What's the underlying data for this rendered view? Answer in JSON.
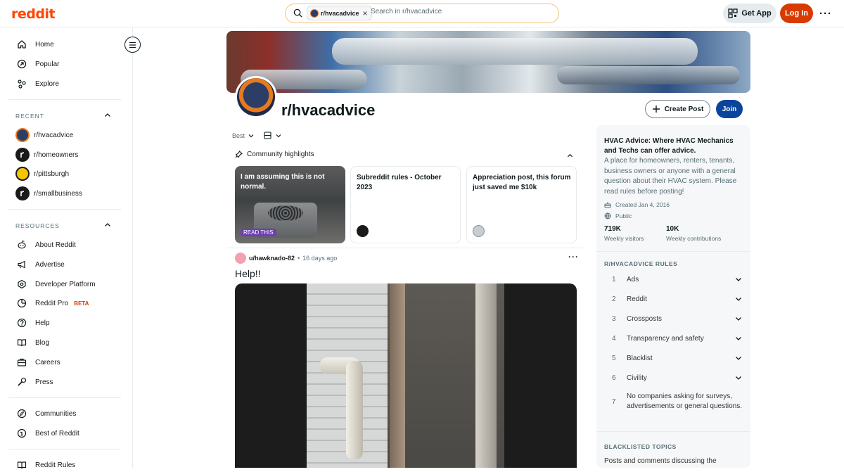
{
  "header": {
    "logo": "reddit",
    "search_chip": "r/hvacadvice",
    "search_placeholder": "Search in r/hvacadvice",
    "get_app": "Get App",
    "login": "Log In"
  },
  "sidebar": {
    "nav": [
      {
        "label": "Home",
        "icon": "home-icon"
      },
      {
        "label": "Popular",
        "icon": "popular-icon"
      },
      {
        "label": "Explore",
        "icon": "explore-icon"
      }
    ],
    "recent_title": "RECENT",
    "recent": [
      {
        "label": "r/hvacadvice",
        "color": "#2d3e66"
      },
      {
        "label": "r/homeowners",
        "color": "#1a1a1b"
      },
      {
        "label": "r/pittsburgh",
        "color": "#f5c400"
      },
      {
        "label": "r/smallbusiness",
        "color": "#1a1a1b"
      }
    ],
    "resources_title": "RESOURCES",
    "resources": [
      {
        "label": "About Reddit",
        "icon": "reddit-icon"
      },
      {
        "label": "Advertise",
        "icon": "megaphone-icon"
      },
      {
        "label": "Developer Platform",
        "icon": "developer-icon"
      },
      {
        "label": "Reddit Pro",
        "icon": "pro-icon",
        "badge": "BETA"
      },
      {
        "label": "Help",
        "icon": "help-icon"
      },
      {
        "label": "Blog",
        "icon": "book-icon"
      },
      {
        "label": "Careers",
        "icon": "briefcase-icon"
      },
      {
        "label": "Press",
        "icon": "microphone-icon"
      }
    ],
    "bottom": [
      {
        "label": "Communities",
        "icon": "communities-icon"
      },
      {
        "label": "Best of Reddit",
        "icon": "best-icon"
      }
    ],
    "rules": "Reddit Rules"
  },
  "community": {
    "name": "r/hvacadvice",
    "create_post": "Create Post",
    "join": "Join"
  },
  "feed": {
    "sort": "Best",
    "highlights_title": "Community highlights",
    "highlights": [
      {
        "title": "I am assuming this is not normal.",
        "badge": "READ THIS"
      },
      {
        "title": "Subreddit rules - October 2023"
      },
      {
        "title": "Appreciation post, this forum just saved me $10k"
      }
    ],
    "post": {
      "author": "u/hawknado-82",
      "time": "16 days ago",
      "title": "Help!!"
    }
  },
  "about": {
    "title": "HVAC Advice: Where HVAC Mechanics and Techs can offer advice.",
    "description": "A place for homeowners, renters, tenants, business owners or anyone with a general question about their HVAC system. Please read rules before posting!",
    "created": "Created Jan 4, 2016",
    "visibility": "Public",
    "visitors_value": "719K",
    "visitors_label": "Weekly visitors",
    "contrib_value": "10K",
    "contrib_label": "Weekly contributions",
    "rules_title": "R/HVACADVICE RULES",
    "rules": [
      {
        "num": "1",
        "text": "Ads"
      },
      {
        "num": "2",
        "text": "Reddit"
      },
      {
        "num": "3",
        "text": "Crossposts"
      },
      {
        "num": "4",
        "text": "Transparency and safety"
      },
      {
        "num": "5",
        "text": "Blacklist"
      },
      {
        "num": "6",
        "text": "Civility"
      },
      {
        "num": "7",
        "text": "No companies asking for surveys, advertisements or general questions."
      }
    ],
    "blacklist_title": "BLACKLISTED TOPICS",
    "blacklist_text": "Posts and comments discussing the"
  },
  "colors": {
    "brand": "#ff4500",
    "login": "#d93a00",
    "join": "#0a449b"
  }
}
